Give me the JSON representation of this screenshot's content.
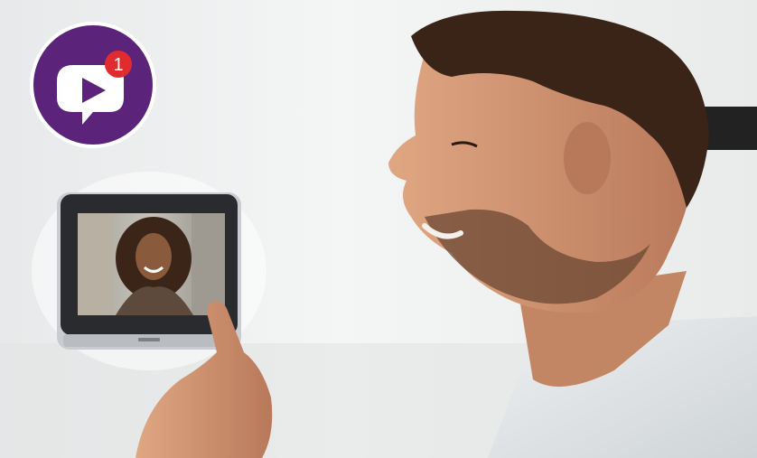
{
  "notification": {
    "count": "1",
    "icon": "video-message-icon",
    "badge_color": "#5b237a",
    "count_color": "#e02b2f"
  },
  "colors": {
    "wall": "#eceeee",
    "shirt": "#dfe3e6",
    "skin": "#c98a64",
    "hair": "#3a2418",
    "monitor_frame": "#2a2b2e",
    "monitor_bezel": "#c9ccd0"
  }
}
